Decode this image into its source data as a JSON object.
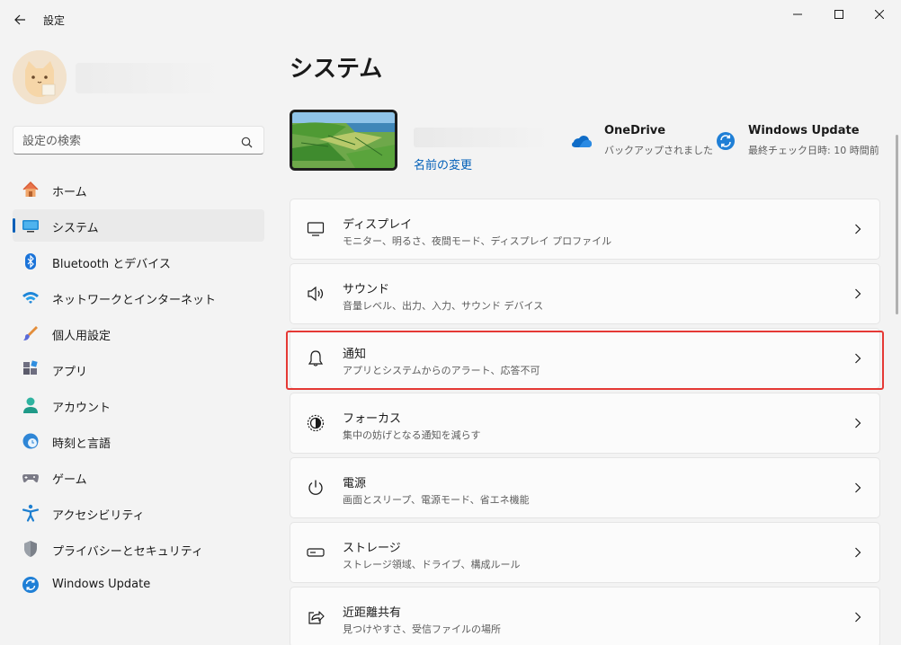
{
  "window": {
    "title": "設定",
    "controls": {
      "minimize": "minimize",
      "maximize": "maximize",
      "close": "close"
    }
  },
  "search": {
    "placeholder": "設定の検索",
    "value": ""
  },
  "sidebar": {
    "items": [
      {
        "label": "ホーム",
        "icon": "home-icon",
        "selected": false
      },
      {
        "label": "システム",
        "icon": "monitor-icon",
        "selected": true
      },
      {
        "label": "Bluetooth とデバイス",
        "icon": "bluetooth-icon",
        "selected": false
      },
      {
        "label": "ネットワークとインターネット",
        "icon": "wifi-icon",
        "selected": false
      },
      {
        "label": "個人用設定",
        "icon": "brush-icon",
        "selected": false
      },
      {
        "label": "アプリ",
        "icon": "apps-icon",
        "selected": false
      },
      {
        "label": "アカウント",
        "icon": "account-icon",
        "selected": false
      },
      {
        "label": "時刻と言語",
        "icon": "clock-globe-icon",
        "selected": false
      },
      {
        "label": "ゲーム",
        "icon": "gamepad-icon",
        "selected": false
      },
      {
        "label": "アクセシビリティ",
        "icon": "accessibility-icon",
        "selected": false
      },
      {
        "label": "プライバシーとセキュリティ",
        "icon": "shield-icon",
        "selected": false
      },
      {
        "label": "Windows Update",
        "icon": "update-icon",
        "selected": false
      }
    ]
  },
  "main": {
    "title": "システム",
    "device": {
      "rename_label": "名前の変更"
    },
    "onedrive": {
      "title": "OneDrive",
      "subtitle": "バックアップされました"
    },
    "windows_update": {
      "title": "Windows Update",
      "subtitle": "最終チェック日時: 10 時間前"
    },
    "cards": [
      {
        "title": "ディスプレイ",
        "subtitle": "モニター、明るさ、夜間モード、ディスプレイ プロファイル",
        "icon": "display-icon"
      },
      {
        "title": "サウンド",
        "subtitle": "音量レベル、出力、入力、サウンド デバイス",
        "icon": "speaker-icon"
      },
      {
        "title": "通知",
        "subtitle": "アプリとシステムからのアラート、応答不可",
        "icon": "bell-icon"
      },
      {
        "title": "フォーカス",
        "subtitle": "集中の妨げとなる通知を減らす",
        "icon": "focus-icon"
      },
      {
        "title": "電源",
        "subtitle": "画面とスリープ、電源モード、省エネ機能",
        "icon": "power-icon"
      },
      {
        "title": "ストレージ",
        "subtitle": "ストレージ領域、ドライブ、構成ルール",
        "icon": "storage-icon"
      },
      {
        "title": "近距離共有",
        "subtitle": "見つけやすさ、受信ファイルの場所",
        "icon": "share-icon"
      }
    ]
  },
  "colors": {
    "accent": "#005fb8",
    "highlight": "#e53935",
    "background": "#f3f3f3",
    "card": "#fbfbfb"
  }
}
